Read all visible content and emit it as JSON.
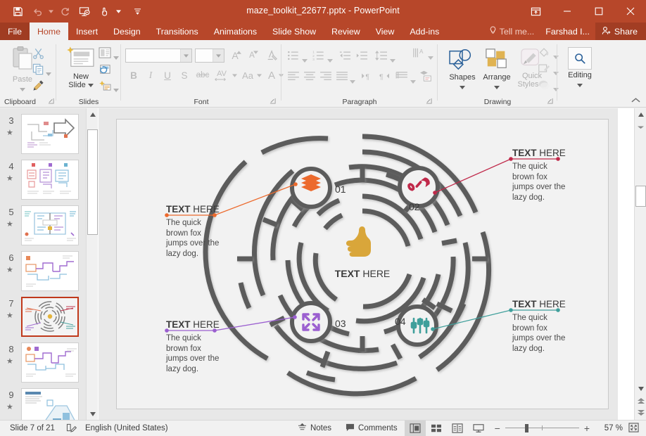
{
  "window": {
    "title": "maze_toolkit_22677.pptx - PowerPoint",
    "quick_access": [
      {
        "name": "save-icon",
        "label": "Save"
      },
      {
        "name": "undo-icon",
        "label": "Undo"
      },
      {
        "name": "redo-icon",
        "label": "Redo"
      },
      {
        "name": "start-presentation-icon",
        "label": "Start From Beginning"
      },
      {
        "name": "touch-mode-icon",
        "label": "Touch/Mouse Mode"
      },
      {
        "name": "customize-qat-icon",
        "label": "Customize Quick Access Toolbar"
      }
    ],
    "controls": [
      {
        "name": "ribbon-display-options-icon",
        "label": "Ribbon Display Options"
      },
      {
        "name": "minimize-icon",
        "label": "Minimize"
      },
      {
        "name": "maximize-icon",
        "label": "Maximize"
      },
      {
        "name": "close-icon",
        "label": "Close"
      }
    ]
  },
  "tabs": [
    {
      "label": "File",
      "active": false,
      "file": true
    },
    {
      "label": "Home",
      "active": true
    },
    {
      "label": "Insert",
      "active": false
    },
    {
      "label": "Design",
      "active": false
    },
    {
      "label": "Transitions",
      "active": false
    },
    {
      "label": "Animations",
      "active": false
    },
    {
      "label": "Slide Show",
      "active": false
    },
    {
      "label": "Review",
      "active": false
    },
    {
      "label": "View",
      "active": false
    },
    {
      "label": "Add-ins",
      "active": false
    }
  ],
  "tabs_right": {
    "tell_me": "Tell me...",
    "user": "Farshad I...",
    "share": "Share"
  },
  "ribbon": {
    "groups": [
      {
        "label": "Clipboard"
      },
      {
        "label": "Slides"
      },
      {
        "label": "Font"
      },
      {
        "label": "Paragraph"
      },
      {
        "label": "Drawing"
      }
    ],
    "clipboard": {
      "paste": "Paste"
    },
    "slides": {
      "new_slide_line1": "New",
      "new_slide_line2": "Slide"
    },
    "font": {
      "name_value": "",
      "name_placeholder": "",
      "size_value": "",
      "size_placeholder": "",
      "bold": "B",
      "italic": "I",
      "underline": "U",
      "shadow": "S",
      "strikethrough": "abc",
      "spacing": "AV",
      "case": "Aa",
      "color": "A",
      "grow": "A",
      "shrink": "A"
    },
    "drawing": {
      "shapes": "Shapes",
      "arrange": "Arrange",
      "quick_styles_l1": "Quick",
      "quick_styles_l2": "Styles"
    },
    "editing": {
      "label": "Editing"
    }
  },
  "thumbnails": {
    "items": [
      {
        "number": "3",
        "selected": false,
        "kind": "arrow"
      },
      {
        "number": "4",
        "selected": false,
        "kind": "grid"
      },
      {
        "number": "5",
        "selected": false,
        "kind": "split"
      },
      {
        "number": "6",
        "selected": false,
        "kind": "zigzag"
      },
      {
        "number": "7",
        "selected": true,
        "kind": "circle-maze"
      },
      {
        "number": "8",
        "selected": false,
        "kind": "zigzag2"
      },
      {
        "number": "9",
        "selected": false,
        "kind": "iso"
      }
    ],
    "star_glyph": "★"
  },
  "slide": {
    "center": {
      "icon": "thumbs-up-icon",
      "icon_color": "#d9a63a",
      "label_bold": "TEXT",
      "label_rest": " HERE"
    },
    "nodes": [
      {
        "number": "01",
        "icon": "layers-icon",
        "color": "#ec6a2d"
      },
      {
        "number": "02",
        "icon": "link-icon",
        "color": "#c0294a"
      },
      {
        "number": "03",
        "icon": "expand-arrows-icon",
        "color": "#9b5fd0"
      },
      {
        "number": "04",
        "icon": "sliders-icon",
        "color": "#3f9f9b"
      }
    ],
    "callouts": [
      {
        "id": "01",
        "color": "#ec6a2d",
        "title_bold": "TEXT",
        "title_rest": " HERE",
        "body": "The quick brown fox jumps over the lazy dog.",
        "align": "left"
      },
      {
        "id": "02",
        "color": "#c0294a",
        "title_bold": "TEXT",
        "title_rest": " HERE",
        "body": "The quick brown fox jumps over the lazy dog.",
        "align": "right"
      },
      {
        "id": "03",
        "color": "#9b5fd0",
        "title_bold": "TEXT",
        "title_rest": " HERE",
        "body": "The quick brown fox jumps over the lazy dog.",
        "align": "left"
      },
      {
        "id": "04",
        "color": "#3f9f9b",
        "title_bold": "TEXT",
        "title_rest": " HERE",
        "body": "The quick brown fox jumps over the lazy dog.",
        "align": "right"
      }
    ],
    "maze_color": "#5c5c5c",
    "background": "#f2f2f2"
  },
  "statusbar": {
    "slide_indicator": "Slide 7 of 21",
    "language": "English (United States)",
    "notes": "Notes",
    "comments": "Comments",
    "views": [
      {
        "name": "normal-view-button",
        "active": true
      },
      {
        "name": "slide-sorter-view-button",
        "active": false
      },
      {
        "name": "reading-view-button",
        "active": false
      },
      {
        "name": "slideshow-view-button",
        "active": false
      }
    ],
    "zoom_out": "−",
    "zoom_in": "+",
    "zoom_level": "57 %"
  }
}
